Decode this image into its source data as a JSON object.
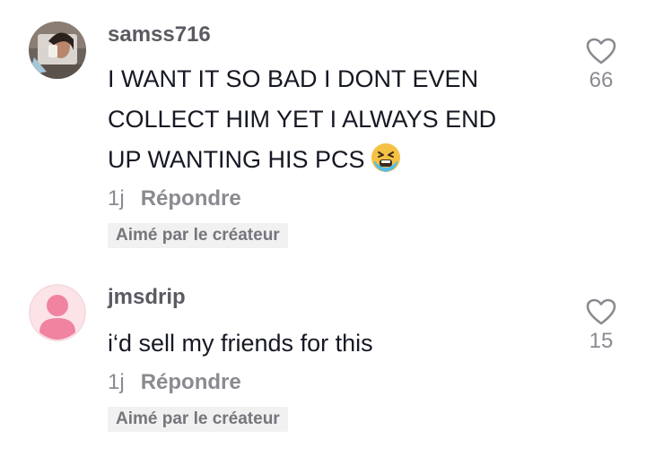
{
  "comments": [
    {
      "username": "samss716",
      "text": "I WANT IT SO BAD I DONT EVEN\nCOLLECT HIM YET I ALWAYS END\nUP WANTING HIS PCS",
      "emoji": "tired-face-emoji",
      "time": "1j",
      "reply_label": "Répondre",
      "badge": "Aimé par le créateur",
      "like_count": "66"
    },
    {
      "username": "jmsdrip",
      "text": "i‘d sell my friends for this",
      "time": "1j",
      "reply_label": "Répondre",
      "badge": "Aimé par le créateur",
      "like_count": "15"
    }
  ],
  "colors": {
    "username": "#5a5b62",
    "text": "#161823",
    "meta": "#8a8b91",
    "badge_bg": "#f1f1f2",
    "default_avatar_bg": "#fbe3e8",
    "default_avatar_fg": "#f083a0"
  }
}
